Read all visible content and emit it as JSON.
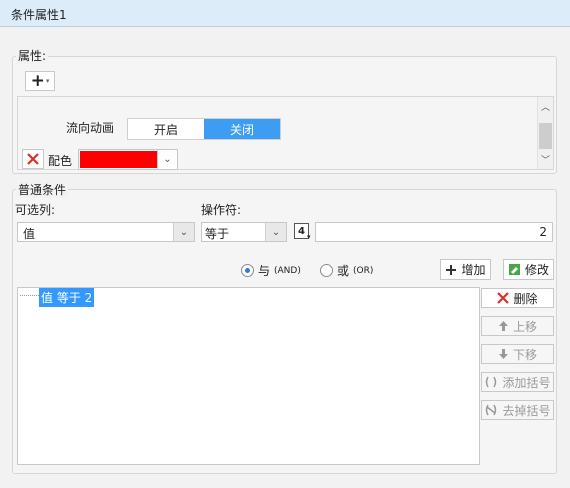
{
  "window": {
    "title": "条件属性1"
  },
  "properties": {
    "group_label": "属性:",
    "add_symbol": "+",
    "flow_label": "流向动画",
    "toggle_on": "开启",
    "toggle_off": "关闭",
    "color_label": "配色",
    "color_value": "#ff0000"
  },
  "conditions": {
    "group_label": "普通条件",
    "column_label": "可选列:",
    "operator_label": "操作符:",
    "column_value": "值",
    "operator_value": "等于",
    "value_input": "2",
    "type_badge": "4",
    "and_label": "与",
    "and_en": "(AND)",
    "or_label": "或",
    "or_en": "(OR)",
    "add_button": "增加",
    "modify_button": "修改",
    "list_item": "值 等于 2"
  },
  "side_buttons": {
    "delete": "删除",
    "move_up": "上移",
    "move_down": "下移",
    "add_bracket": "添加括号",
    "remove_bracket": "去掉括号"
  }
}
